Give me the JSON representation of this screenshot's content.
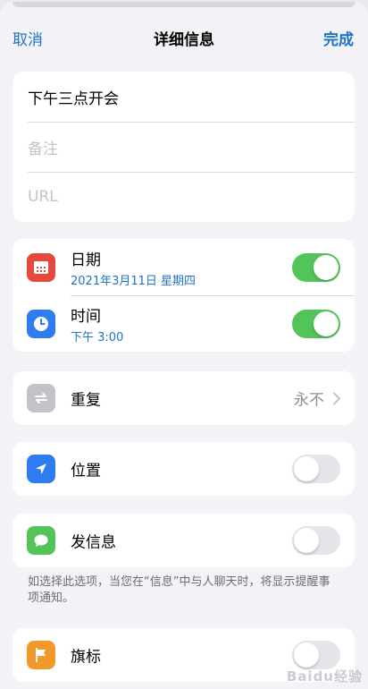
{
  "navbar": {
    "cancel_label": "取消",
    "title": "详细信息",
    "done_label": "完成"
  },
  "details": {
    "title": "下午三点开会",
    "notes_placeholder": "备注",
    "url_placeholder": "URL"
  },
  "date_time": {
    "date_label": "日期",
    "date_value": "2021年3月11日 星期四",
    "date_enabled": true,
    "time_label": "时间",
    "time_value": "下午 3:00",
    "time_enabled": true
  },
  "repeat": {
    "label": "重复",
    "value": "永不"
  },
  "location": {
    "label": "位置",
    "enabled": false
  },
  "messaging": {
    "label": "发信息",
    "enabled": false,
    "footnote": "如选择此选项，当您在“信息”中与人聊天时，将显示提醒事项通知。"
  },
  "flag": {
    "label": "旗标",
    "enabled": false
  },
  "watermark": "Baidu经验",
  "colors": {
    "accent": "#1f72c6",
    "calendar_icon_bg": "#e5483d",
    "clock_icon_bg": "#2f7bf0",
    "repeat_icon_bg": "#c2c2c7",
    "location_icon_bg": "#2f7bf0",
    "message_icon_bg": "#53c458",
    "flag_icon_bg": "#f19a2a",
    "toggle_on": "#53c458"
  },
  "icons": {
    "calendar": "calendar-icon",
    "clock": "clock-icon",
    "repeat": "repeat-icon",
    "location": "location-arrow-icon",
    "message": "message-bubble-icon",
    "flag": "flag-icon",
    "chevron": "chevron-right-icon"
  }
}
